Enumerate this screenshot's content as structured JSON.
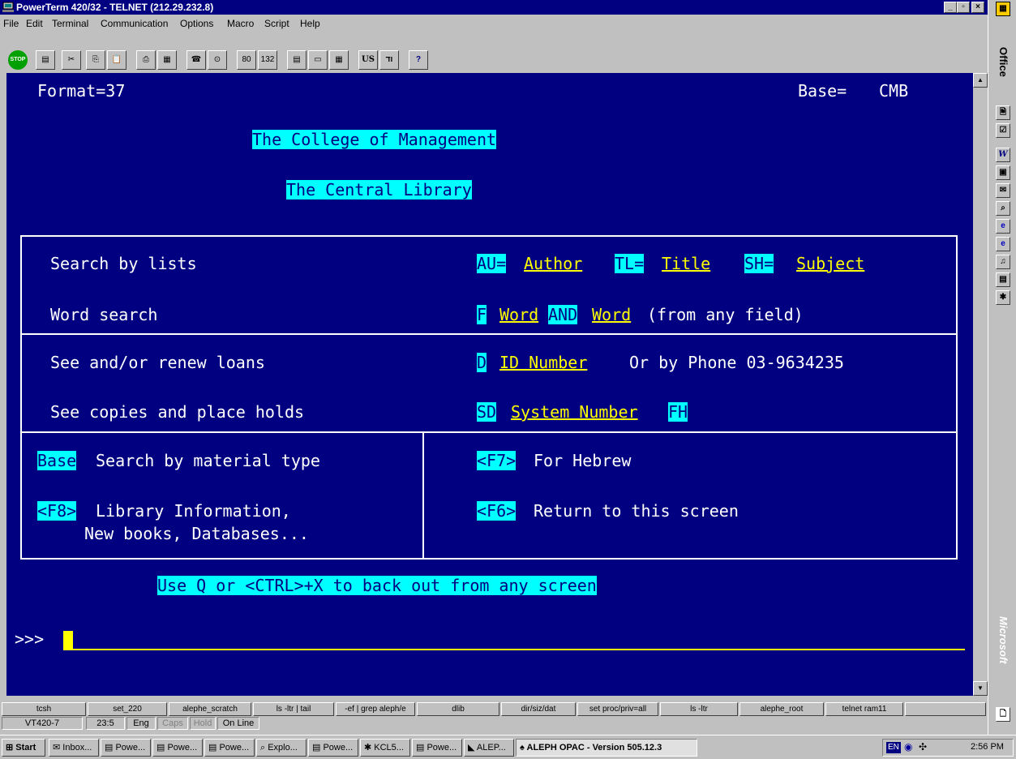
{
  "window": {
    "title": "PowerTerm 420/32 - TELNET (212.29.232.8)"
  },
  "menu": [
    "File",
    "Edit",
    "Terminal",
    "Communication",
    "Options",
    "Macro",
    "Script",
    "Help"
  ],
  "toolbar": {
    "stop": "STOP",
    "cols80": "80",
    "cols132": "132",
    "lang_us": "US",
    "lang_heb": "וד",
    "help": "?"
  },
  "terminal": {
    "format": "Format=37",
    "base_label": "Base=",
    "base_value": "CMB",
    "college": "The College of Management",
    "library": "The Central Library",
    "rows": {
      "search_lists": "Search by lists",
      "au_code": "AU=",
      "author": "Author",
      "tl_code": "TL=",
      "title": "Title",
      "sh_code": "SH=",
      "subject": "Subject",
      "word_search": "Word search",
      "f_code": "F",
      "word1": "Word",
      "and_code": "AND",
      "word2": "Word",
      "from_field": "(from any field)",
      "renew_loans": "See and/or renew loans",
      "d_code": "D",
      "id_number": "ID Number",
      "phone": "Or by Phone 03-9634235",
      "copies_holds": "See copies and place holds",
      "sd_code": "SD",
      "system_number": "System Number",
      "fh_code": "FH",
      "base_code": "Base",
      "material_type": "Search by material type",
      "f7_code": "<F7>",
      "for_hebrew": "For Hebrew",
      "f8_code": "<F8>",
      "lib_info": "Library Information,",
      "new_books": "New books, Databases...",
      "f6_code": "<F6>",
      "return_screen": "Return to this screen"
    },
    "back_out": "Use Q or <CTRL>+X to back out from any screen",
    "prompt": ">>>"
  },
  "function_keys": [
    "tcsh",
    "set_220",
    "alephe_scratch",
    "ls -ltr | tail",
    "-ef | grep aleph/e",
    "dlib",
    "dir/siz/dat",
    "set proc/priv=all",
    "ls -ltr",
    "alephe_root",
    "telnet ram11"
  ],
  "status": {
    "terminal": "VT420-7",
    "position": "23:5",
    "lang": "Eng",
    "caps": "Caps",
    "hold": "Hold",
    "online": "On Line"
  },
  "office_bar": {
    "label": "Office",
    "brand": "Microsoft"
  },
  "taskbar": {
    "start": "Start",
    "tasks": [
      "Inbox...",
      "Powe...",
      "Powe...",
      "Powe...",
      "Explo...",
      "Powe...",
      "KCL5...",
      "Powe...",
      "ALEP...",
      "ALEPH OPAC - Version 505.12.3"
    ],
    "tray_lang": "EN",
    "clock": "2:56 PM"
  }
}
